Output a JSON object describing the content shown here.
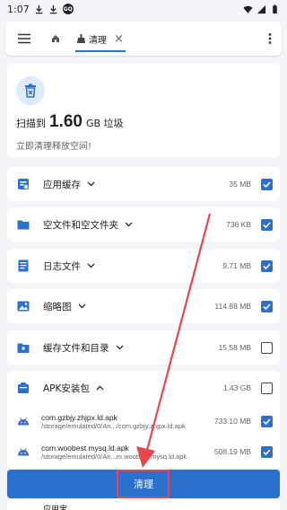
{
  "status_bar": {
    "time": "1:07",
    "badge": "GQ"
  },
  "toolbar": {
    "menu_icon": "hamburger-icon",
    "home_icon": "home-icon",
    "tab_label": "清理",
    "tab_icon": "broom-icon",
    "close_icon": "close-icon",
    "more_icon": "more-vertical-icon"
  },
  "summary": {
    "icon": "trash-bin-icon",
    "prefix": "扫描到",
    "size": "1.60",
    "unit": "GB 垃圾",
    "subtitle": "立即清理释放空间!"
  },
  "categories": [
    {
      "label": "应用缓存",
      "size": "35 MB",
      "icon": "app-cache-icon",
      "checked": true,
      "expanded": false
    },
    {
      "label": "空文件和空文件夹",
      "size": "736 KB",
      "icon": "folder-icon",
      "checked": true,
      "expanded": false
    },
    {
      "label": "日志文件",
      "size": "9.71 MB",
      "icon": "log-file-icon",
      "checked": true,
      "expanded": false
    },
    {
      "label": "缩略图",
      "size": "114.88 MB",
      "icon": "image-icon",
      "checked": true,
      "expanded": false
    },
    {
      "label": "缓存文件和目录",
      "size": "15.58 MB",
      "icon": "cache-folder-icon",
      "checked": false,
      "expanded": false
    },
    {
      "label": "APK安装包",
      "size": "1.43 GB",
      "icon": "apk-package-icon",
      "checked": false,
      "expanded": true
    }
  ],
  "apk_items": [
    {
      "name": "com.gzbjy.zhjpx.ld.apk",
      "path": "/storage/emulated/0/An.../com.gzbjy.zhjpx.ld.apk",
      "size": "733.10 MB",
      "checked": true
    },
    {
      "name": "com.woobest.mysq.ld.apk",
      "path": "/storage/emulated/0/An...m.woobest.mysq.ld.apk",
      "size": "508.19 MB",
      "checked": true
    }
  ],
  "next_row": {
    "label": "应用宝"
  },
  "clean_button": {
    "label": "清理"
  },
  "colors": {
    "accent": "#2b6fcf",
    "annotation": "#e8464a",
    "background": "#f3f5f9"
  }
}
